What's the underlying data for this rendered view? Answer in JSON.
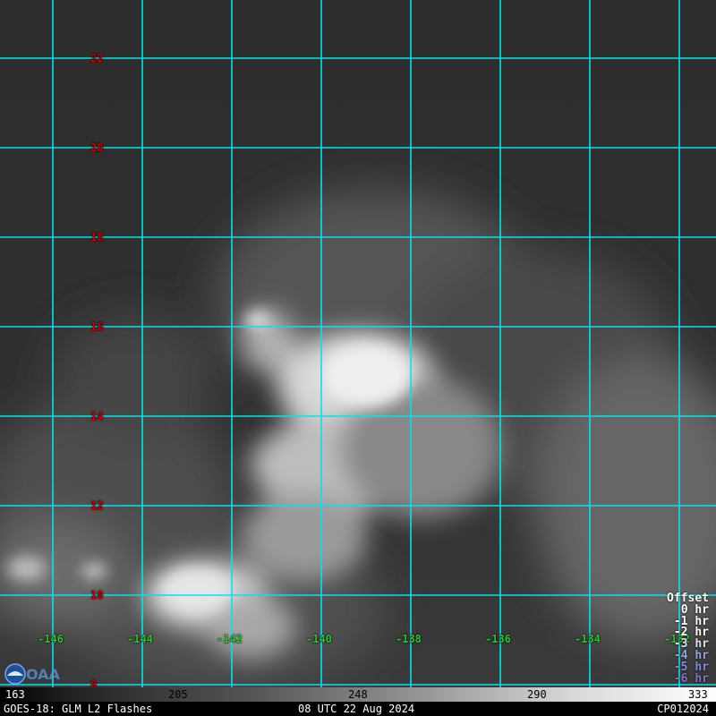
{
  "map": {
    "lat_labels": [
      "22",
      "20",
      "18",
      "16",
      "14",
      "12",
      "10",
      "8"
    ],
    "lon_labels": [
      "-146",
      "-144",
      "-142",
      "-140",
      "-138",
      "-136",
      "-134",
      "-132"
    ],
    "grid_color": "#00e5ee",
    "lat_label_color": "#cc0000",
    "lon_label_color": "#22cc22"
  },
  "legend": {
    "title": "Offset",
    "items": [
      {
        "label": "0 hr",
        "color": "#ffffff"
      },
      {
        "label": "-1 hr",
        "color": "#ffffff"
      },
      {
        "label": "-2 hr",
        "color": "#ffffff"
      },
      {
        "label": "-3 hr",
        "color": "#d8e0f0"
      },
      {
        "label": "-4 hr",
        "color": "#8fa8e0"
      },
      {
        "label": "-5 hr",
        "color": "#7d8fd8"
      },
      {
        "label": "-6 hr",
        "color": "#8a6fc8"
      }
    ]
  },
  "colorbar": {
    "ticks": [
      "163",
      "205",
      "248",
      "290",
      "333"
    ]
  },
  "footer": {
    "left": "GOES-18: GLM L2 Flashes",
    "center": "08 UTC 22 Aug 2024",
    "right": "CP012024"
  }
}
